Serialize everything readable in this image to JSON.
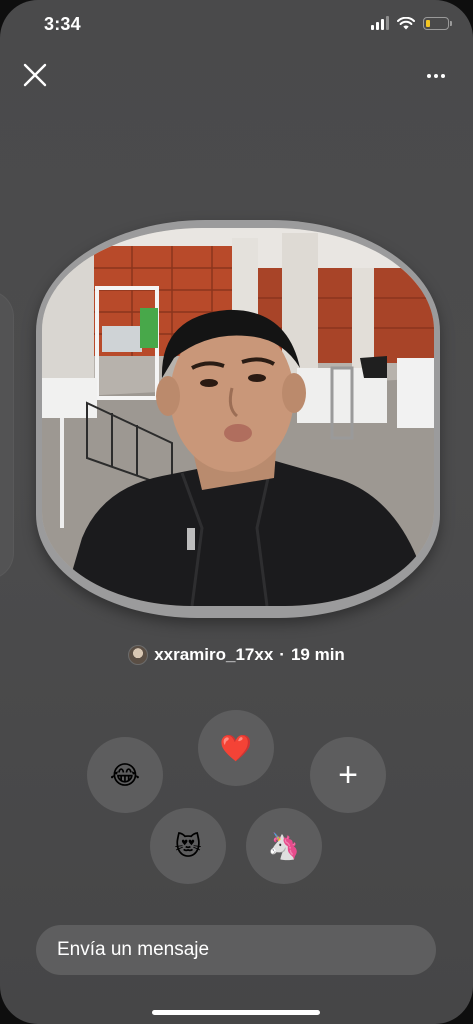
{
  "status_bar": {
    "time": "3:34",
    "battery_level": 0.2,
    "battery_color": "#f3c623"
  },
  "top_bar": {
    "close_icon": "close-icon",
    "more_icon": "more-horizontal-icon"
  },
  "story": {
    "username": "xxramiro_17xx",
    "time_ago": "19 min",
    "separator": "·"
  },
  "reactions": [
    {
      "emoji": "😂",
      "name": "laughing-reaction"
    },
    {
      "emoji": "❤️",
      "name": "heart-reaction"
    },
    {
      "emoji": "😻",
      "name": "heart-eyes-cat-reaction"
    },
    {
      "emoji": "🦄",
      "name": "unicorn-reaction"
    }
  ],
  "add_reaction": {
    "label": "+"
  },
  "message_input": {
    "placeholder": "Envía un mensaje"
  },
  "colors": {
    "background": "#4a4a4b",
    "button": "#5d5d5e",
    "heart": "#e0241b"
  }
}
